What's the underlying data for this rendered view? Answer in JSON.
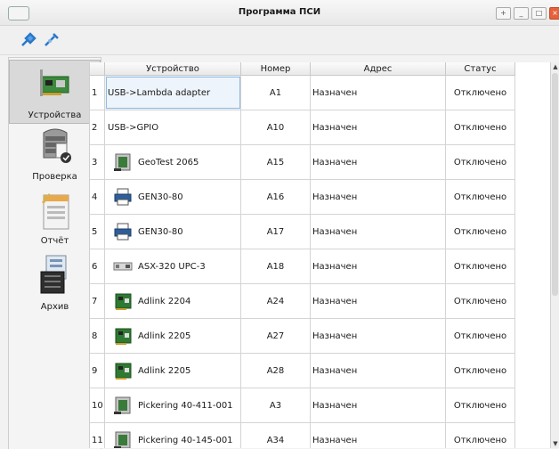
{
  "window": {
    "title": "Программа ПСИ",
    "buttons": [
      "+",
      "_",
      "□",
      "×"
    ]
  },
  "toolbar": {
    "buttons": [
      "connect-icon",
      "disconnect-icon"
    ]
  },
  "sidebar": {
    "items": [
      {
        "label": "Устройства",
        "icon": "devices-icon",
        "selected": true
      },
      {
        "label": "Проверка",
        "icon": "check-icon"
      },
      {
        "label": "Отчёт",
        "icon": "report-icon"
      },
      {
        "label": "Архив",
        "icon": "archive-icon"
      }
    ]
  },
  "table": {
    "headers": [
      "Устройство",
      "Номер",
      "Адрес",
      "Статус"
    ],
    "rows": [
      {
        "n": "1",
        "device": "USB->Lambda adapter",
        "icon": "",
        "num": "A1",
        "addr": "Назначен",
        "status": "Отключено"
      },
      {
        "n": "2",
        "device": "USB->GPIO",
        "icon": "",
        "num": "A10",
        "addr": "Назначен",
        "status": "Отключено"
      },
      {
        "n": "3",
        "device": "GeoTest 2065",
        "icon": "card-icon",
        "num": "A15",
        "addr": "Назначен",
        "status": "Отключено"
      },
      {
        "n": "4",
        "device": "GEN30-80",
        "icon": "printer-icon",
        "num": "A16",
        "addr": "Назначен",
        "status": "Отключено"
      },
      {
        "n": "5",
        "device": "GEN30-80",
        "icon": "printer-icon",
        "num": "A17",
        "addr": "Назначен",
        "status": "Отключено"
      },
      {
        "n": "6",
        "device": "ASX-320 UPC-3",
        "icon": "rack-icon",
        "num": "A18",
        "addr": "Назначен",
        "status": "Отключено"
      },
      {
        "n": "7",
        "device": "Adlink 2204",
        "icon": "board-icon",
        "num": "A24",
        "addr": "Назначен",
        "status": "Отключено"
      },
      {
        "n": "8",
        "device": "Adlink 2205",
        "icon": "board-icon",
        "num": "A27",
        "addr": "Назначен",
        "status": "Отключено"
      },
      {
        "n": "9",
        "device": "Adlink 2205",
        "icon": "board-icon",
        "num": "A28",
        "addr": "Назначен",
        "status": "Отключено"
      },
      {
        "n": "10",
        "device": "Pickering 40-411-001",
        "icon": "card-icon",
        "num": "A3",
        "addr": "Назначен",
        "status": "Отключено"
      },
      {
        "n": "11",
        "device": "Pickering 40-145-001",
        "icon": "card-icon",
        "num": "A34",
        "addr": "Назначен",
        "status": "Отключено"
      }
    ]
  }
}
